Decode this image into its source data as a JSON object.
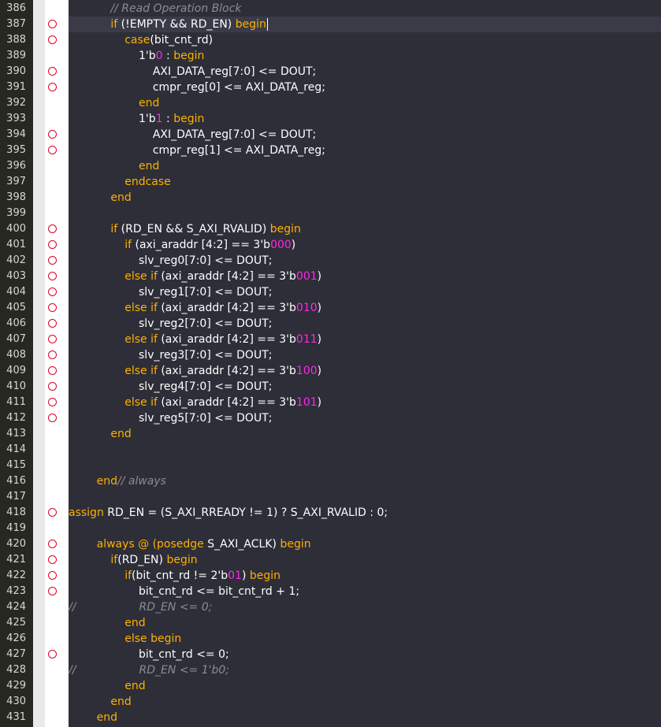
{
  "editor": {
    "language": "verilog",
    "current_line": 387,
    "colors": {
      "keyword": "#ffb000",
      "number": "#ff28e6",
      "comment": "#8b8b95",
      "text": "#ffffff",
      "background": "#2d2e38",
      "breakpoint": "#e0002a"
    },
    "lines": [
      {
        "n": "386",
        "bp": false,
        "segs": [
          [
            "            ",
            ""
          ],
          [
            "// Read Operation Block",
            "cm"
          ]
        ]
      },
      {
        "n": "387",
        "bp": true,
        "segs": [
          [
            "            ",
            ""
          ],
          [
            "if",
            "kw"
          ],
          [
            " (!EMPTY && RD_EN) ",
            ""
          ],
          [
            "begin",
            "kw"
          ]
        ]
      },
      {
        "n": "388",
        "bp": true,
        "segs": [
          [
            "                ",
            ""
          ],
          [
            "case",
            "kw"
          ],
          [
            "(bit_cnt_rd)",
            ""
          ]
        ]
      },
      {
        "n": "389",
        "bp": false,
        "segs": [
          [
            "                    ",
            ""
          ],
          [
            "1'b",
            ""
          ],
          [
            "0",
            "num"
          ],
          [
            " : ",
            ""
          ],
          [
            "begin",
            "kw"
          ]
        ]
      },
      {
        "n": "390",
        "bp": true,
        "segs": [
          [
            "                        ",
            ""
          ],
          [
            "AXI_DATA_reg[7:0] <= DOUT;",
            ""
          ]
        ]
      },
      {
        "n": "391",
        "bp": true,
        "segs": [
          [
            "                        ",
            ""
          ],
          [
            "cmpr_reg[0] <= AXI_DATA_reg;",
            ""
          ]
        ]
      },
      {
        "n": "392",
        "bp": false,
        "segs": [
          [
            "                    ",
            ""
          ],
          [
            "end",
            "kw"
          ]
        ]
      },
      {
        "n": "393",
        "bp": false,
        "segs": [
          [
            "                    ",
            ""
          ],
          [
            "1'b",
            ""
          ],
          [
            "1",
            "num"
          ],
          [
            " : ",
            ""
          ],
          [
            "begin",
            "kw"
          ]
        ]
      },
      {
        "n": "394",
        "bp": true,
        "segs": [
          [
            "                        ",
            ""
          ],
          [
            "AXI_DATA_reg[7:0] <= DOUT;",
            ""
          ]
        ]
      },
      {
        "n": "395",
        "bp": true,
        "segs": [
          [
            "                        ",
            ""
          ],
          [
            "cmpr_reg[1] <= AXI_DATA_reg;",
            ""
          ]
        ]
      },
      {
        "n": "396",
        "bp": false,
        "segs": [
          [
            "                    ",
            ""
          ],
          [
            "end",
            "kw"
          ]
        ]
      },
      {
        "n": "397",
        "bp": false,
        "segs": [
          [
            "                ",
            ""
          ],
          [
            "endcase",
            "kw"
          ]
        ]
      },
      {
        "n": "398",
        "bp": false,
        "segs": [
          [
            "            ",
            ""
          ],
          [
            "end",
            "kw"
          ]
        ]
      },
      {
        "n": "399",
        "bp": false,
        "segs": []
      },
      {
        "n": "400",
        "bp": true,
        "segs": [
          [
            "            ",
            ""
          ],
          [
            "if",
            "kw"
          ],
          [
            " (RD_EN && S_AXI_RVALID) ",
            ""
          ],
          [
            "begin",
            "kw"
          ]
        ]
      },
      {
        "n": "401",
        "bp": true,
        "segs": [
          [
            "                ",
            ""
          ],
          [
            "if",
            "kw"
          ],
          [
            " (axi_araddr [4:2] == 3'b",
            ""
          ],
          [
            "000",
            "num"
          ],
          [
            ")",
            ""
          ]
        ]
      },
      {
        "n": "402",
        "bp": true,
        "segs": [
          [
            "                    ",
            ""
          ],
          [
            "slv_reg0[7:0] <= DOUT;",
            ""
          ]
        ]
      },
      {
        "n": "403",
        "bp": true,
        "segs": [
          [
            "                ",
            ""
          ],
          [
            "else if",
            "kw"
          ],
          [
            " (axi_araddr [4:2] == 3'b",
            ""
          ],
          [
            "001",
            "num"
          ],
          [
            ")",
            ""
          ]
        ]
      },
      {
        "n": "404",
        "bp": true,
        "segs": [
          [
            "                    ",
            ""
          ],
          [
            "slv_reg1[7:0] <= DOUT;",
            ""
          ]
        ]
      },
      {
        "n": "405",
        "bp": true,
        "segs": [
          [
            "                ",
            ""
          ],
          [
            "else if",
            "kw"
          ],
          [
            " (axi_araddr [4:2] == 3'b",
            ""
          ],
          [
            "010",
            "num"
          ],
          [
            ")",
            ""
          ]
        ]
      },
      {
        "n": "406",
        "bp": true,
        "segs": [
          [
            "                    ",
            ""
          ],
          [
            "slv_reg2[7:0] <= DOUT;",
            ""
          ]
        ]
      },
      {
        "n": "407",
        "bp": true,
        "segs": [
          [
            "                ",
            ""
          ],
          [
            "else if",
            "kw"
          ],
          [
            " (axi_araddr [4:2] == 3'b",
            ""
          ],
          [
            "011",
            "num"
          ],
          [
            ")",
            ""
          ]
        ]
      },
      {
        "n": "408",
        "bp": true,
        "segs": [
          [
            "                    ",
            ""
          ],
          [
            "slv_reg3[7:0] <= DOUT;",
            ""
          ]
        ]
      },
      {
        "n": "409",
        "bp": true,
        "segs": [
          [
            "                ",
            ""
          ],
          [
            "else if",
            "kw"
          ],
          [
            " (axi_araddr [4:2] == 3'b",
            ""
          ],
          [
            "100",
            "num"
          ],
          [
            ")",
            ""
          ]
        ]
      },
      {
        "n": "410",
        "bp": true,
        "segs": [
          [
            "                    ",
            ""
          ],
          [
            "slv_reg4[7:0] <= DOUT;",
            ""
          ]
        ]
      },
      {
        "n": "411",
        "bp": true,
        "segs": [
          [
            "                ",
            ""
          ],
          [
            "else if",
            "kw"
          ],
          [
            " (axi_araddr [4:2] == 3'b",
            ""
          ],
          [
            "101",
            "num"
          ],
          [
            ")",
            ""
          ]
        ]
      },
      {
        "n": "412",
        "bp": true,
        "segs": [
          [
            "                    ",
            ""
          ],
          [
            "slv_reg5[7:0] <= DOUT;",
            ""
          ]
        ]
      },
      {
        "n": "413",
        "bp": false,
        "segs": [
          [
            "            ",
            ""
          ],
          [
            "end",
            "kw"
          ]
        ]
      },
      {
        "n": "414",
        "bp": false,
        "segs": []
      },
      {
        "n": "415",
        "bp": false,
        "segs": []
      },
      {
        "n": "416",
        "bp": false,
        "segs": [
          [
            "        ",
            ""
          ],
          [
            "end",
            "kw"
          ],
          [
            "// always",
            "cm"
          ]
        ]
      },
      {
        "n": "417",
        "bp": false,
        "segs": []
      },
      {
        "n": "418",
        "bp": true,
        "segs": [
          [
            "assign",
            "kw"
          ],
          [
            " RD_EN = (S_AXI_RREADY != 1) ? S_AXI_RVALID : 0;",
            ""
          ]
        ]
      },
      {
        "n": "419",
        "bp": false,
        "segs": []
      },
      {
        "n": "420",
        "bp": true,
        "segs": [
          [
            "        ",
            ""
          ],
          [
            "always @ (posedge",
            "kw"
          ],
          [
            " S_AXI_ACLK) ",
            ""
          ],
          [
            "begin",
            "kw"
          ]
        ]
      },
      {
        "n": "421",
        "bp": true,
        "segs": [
          [
            "            ",
            ""
          ],
          [
            "if",
            "kw"
          ],
          [
            "(RD_EN) ",
            ""
          ],
          [
            "begin",
            "kw"
          ]
        ]
      },
      {
        "n": "422",
        "bp": true,
        "segs": [
          [
            "                ",
            ""
          ],
          [
            "if",
            "kw"
          ],
          [
            "(bit_cnt_rd != 2'b",
            ""
          ],
          [
            "01",
            "num"
          ],
          [
            ") ",
            ""
          ],
          [
            "begin",
            "kw"
          ]
        ]
      },
      {
        "n": "423",
        "bp": true,
        "segs": [
          [
            "                    ",
            ""
          ],
          [
            "bit_cnt_rd <= bit_cnt_rd + 1;",
            ""
          ]
        ]
      },
      {
        "n": "424",
        "bp": false,
        "segs": [
          [
            "//                  RD_EN <= 0;",
            "cm"
          ]
        ]
      },
      {
        "n": "425",
        "bp": false,
        "segs": [
          [
            "                ",
            ""
          ],
          [
            "end",
            "kw"
          ]
        ]
      },
      {
        "n": "426",
        "bp": false,
        "segs": [
          [
            "                ",
            ""
          ],
          [
            "else begin",
            "kw"
          ]
        ]
      },
      {
        "n": "427",
        "bp": true,
        "segs": [
          [
            "                    ",
            ""
          ],
          [
            "bit_cnt_rd <= 0;",
            ""
          ]
        ]
      },
      {
        "n": "428",
        "bp": false,
        "segs": [
          [
            "//                  RD_EN <= 1'b0;",
            "cm"
          ]
        ]
      },
      {
        "n": "429",
        "bp": false,
        "segs": [
          [
            "                ",
            ""
          ],
          [
            "end",
            "kw"
          ]
        ]
      },
      {
        "n": "430",
        "bp": false,
        "segs": [
          [
            "            ",
            ""
          ],
          [
            "end",
            "kw"
          ]
        ]
      },
      {
        "n": "431",
        "bp": false,
        "segs": [
          [
            "        ",
            ""
          ],
          [
            "end",
            "kw"
          ]
        ]
      }
    ]
  }
}
